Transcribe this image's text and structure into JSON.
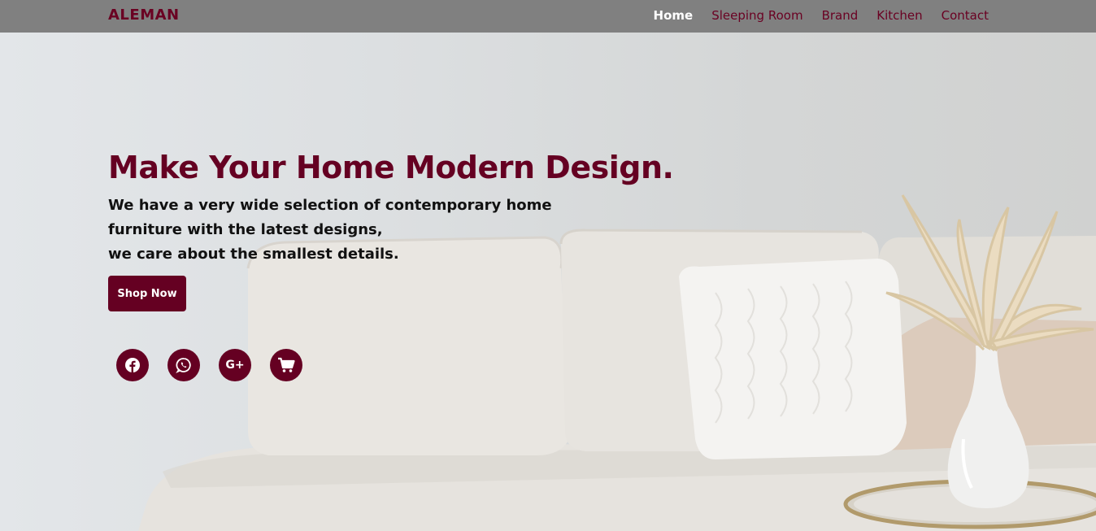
{
  "nav": {
    "brand": "ALEMAN",
    "links": [
      {
        "label": "Home",
        "active": true
      },
      {
        "label": "Sleeping Room",
        "active": false
      },
      {
        "label": "Brand",
        "active": false
      },
      {
        "label": "Kitchen",
        "active": false
      },
      {
        "label": "Contact",
        "active": false
      }
    ]
  },
  "hero": {
    "title": "Make Your Home Modern Design.",
    "lines": [
      "We have a very wide selection of contemporary home",
      "furniture with the latest designs,",
      "we care about the smallest details."
    ],
    "cta_label": "Shop Now"
  },
  "social": {
    "icons": [
      "facebook-icon",
      "whatsapp-icon",
      "google-plus-icon",
      "cart-icon"
    ],
    "gplus_text": "G+"
  },
  "colors": {
    "accent": "#650022",
    "navbar": "#808080",
    "nav_active": "#ffffff"
  }
}
